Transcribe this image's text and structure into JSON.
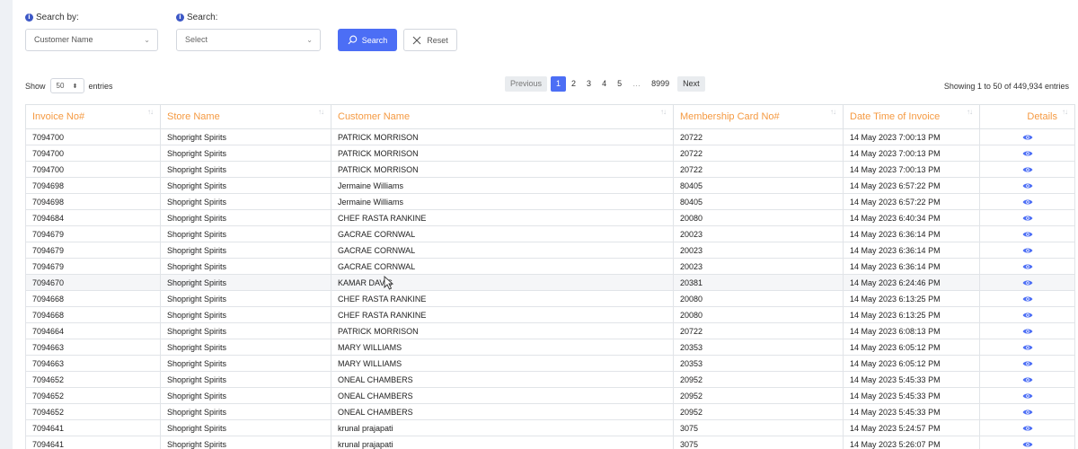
{
  "filters": {
    "search_by_label": "Search by:",
    "search_by_value": "Customer Name",
    "search_label": "Search:",
    "search_placeholder": "Select",
    "search_button": "Search",
    "reset_button": "Reset"
  },
  "length": {
    "show": "Show",
    "value": "50",
    "entries": "entries"
  },
  "pagination": {
    "previous": "Previous",
    "pages": [
      "1",
      "2",
      "3",
      "4",
      "5"
    ],
    "ellipsis": "…",
    "last": "8999",
    "next": "Next",
    "active": "1"
  },
  "info_text": "Showing 1 to 50 of 449,934 entries",
  "table": {
    "headers": [
      "Invoice No#",
      "Store Name",
      "Customer Name",
      "Membership Card No#",
      "Date Time of Invoice",
      "Details"
    ],
    "rows": [
      [
        "7094700",
        "Shopright Spirits",
        "PATRICK MORRISON",
        "20722",
        "14 May 2023 7:00:13 PM"
      ],
      [
        "7094700",
        "Shopright Spirits",
        "PATRICK MORRISON",
        "20722",
        "14 May 2023 7:00:13 PM"
      ],
      [
        "7094700",
        "Shopright Spirits",
        "PATRICK MORRISON",
        "20722",
        "14 May 2023 7:00:13 PM"
      ],
      [
        "7094698",
        "Shopright Spirits",
        "Jermaine Williams",
        "80405",
        "14 May 2023 6:57:22 PM"
      ],
      [
        "7094698",
        "Shopright Spirits",
        "Jermaine Williams",
        "80405",
        "14 May 2023 6:57:22 PM"
      ],
      [
        "7094684",
        "Shopright Spirits",
        "CHEF RASTA RANKINE",
        "20080",
        "14 May 2023 6:40:34 PM"
      ],
      [
        "7094679",
        "Shopright Spirits",
        "GACRAE CORNWAL",
        "20023",
        "14 May 2023 6:36:14 PM"
      ],
      [
        "7094679",
        "Shopright Spirits",
        "GACRAE CORNWAL",
        "20023",
        "14 May 2023 6:36:14 PM"
      ],
      [
        "7094679",
        "Shopright Spirits",
        "GACRAE CORNWAL",
        "20023",
        "14 May 2023 6:36:14 PM"
      ],
      [
        "7094670",
        "Shopright Spirits",
        "KAMAR DAVIS",
        "20381",
        "14 May 2023 6:24:46 PM"
      ],
      [
        "7094668",
        "Shopright Spirits",
        "CHEF RASTA RANKINE",
        "20080",
        "14 May 2023 6:13:25 PM"
      ],
      [
        "7094668",
        "Shopright Spirits",
        "CHEF RASTA RANKINE",
        "20080",
        "14 May 2023 6:13:25 PM"
      ],
      [
        "7094664",
        "Shopright Spirits",
        "PATRICK MORRISON",
        "20722",
        "14 May 2023 6:08:13 PM"
      ],
      [
        "7094663",
        "Shopright Spirits",
        "MARY WILLIAMS",
        "20353",
        "14 May 2023 6:05:12 PM"
      ],
      [
        "7094663",
        "Shopright Spirits",
        "MARY WILLIAMS",
        "20353",
        "14 May 2023 6:05:12 PM"
      ],
      [
        "7094652",
        "Shopright Spirits",
        "ONEAL CHAMBERS",
        "20952",
        "14 May 2023 5:45:33 PM"
      ],
      [
        "7094652",
        "Shopright Spirits",
        "ONEAL CHAMBERS",
        "20952",
        "14 May 2023 5:45:33 PM"
      ],
      [
        "7094652",
        "Shopright Spirits",
        "ONEAL CHAMBERS",
        "20952",
        "14 May 2023 5:45:33 PM"
      ],
      [
        "7094641",
        "Shopright Spirits",
        "krunal prajapati",
        "3075",
        "14 May 2023 5:24:57 PM"
      ],
      [
        "7094641",
        "Shopright Spirits",
        "krunal prajapati",
        "3075",
        "14 May 2023 5:26:07 PM"
      ]
    ]
  },
  "colors": {
    "primary": "#4c6ef5",
    "header_text": "#f59a42",
    "eye": "#4c6ef5"
  },
  "icons": {
    "info": "info-circle-icon",
    "search": "search-icon",
    "reset": "close-icon",
    "details": "eye-icon",
    "sort": "sort-arrows-icon"
  }
}
